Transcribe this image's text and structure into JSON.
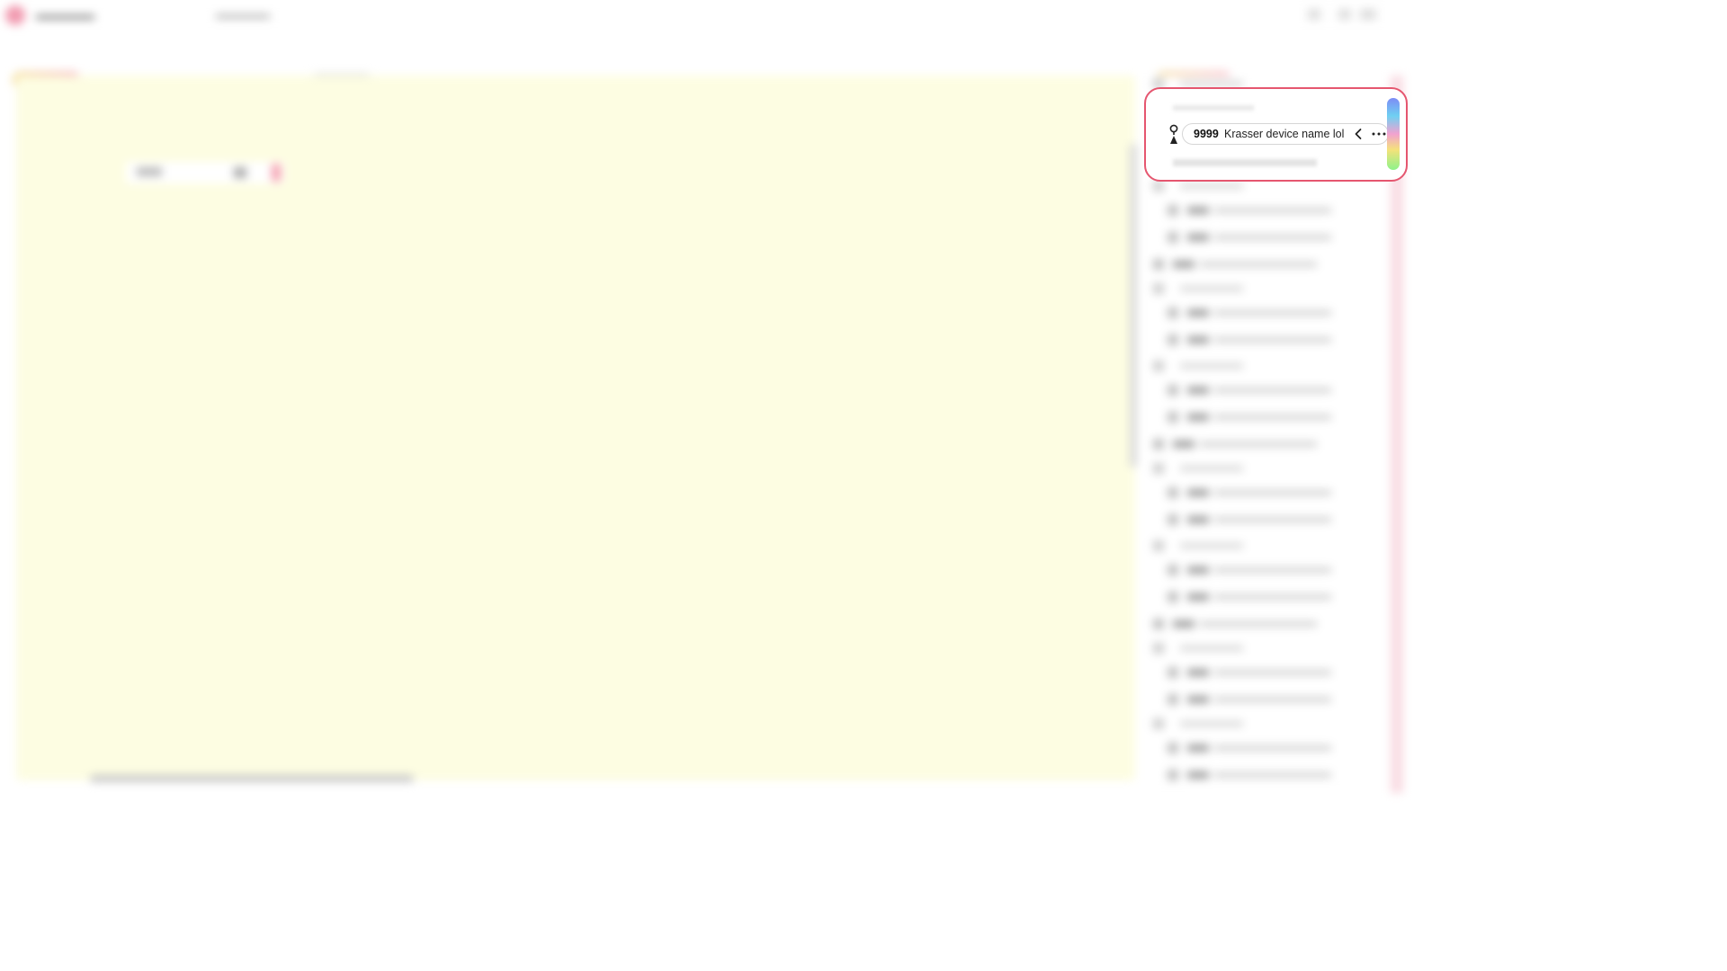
{
  "device": {
    "id": "9999",
    "name": "Krasser device name lol"
  },
  "icons": {
    "device": "device-icon",
    "collapse": "chevron-left-icon",
    "more": "more-horizontal-icon"
  },
  "colors": {
    "highlight_border": "#e5566f",
    "canvas_background": "#fdfde2"
  }
}
